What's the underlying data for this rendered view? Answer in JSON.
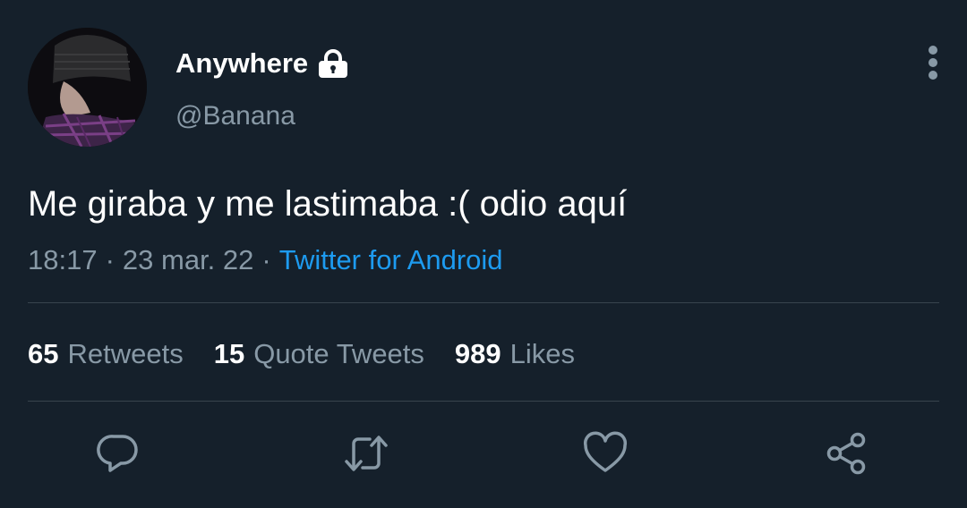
{
  "user": {
    "display_name": "Anywhere",
    "handle": "@Banana"
  },
  "tweet": {
    "text": "Me giraba y me lastimaba :( odio aquí",
    "time": "18:17",
    "date": "23 mar. 22",
    "source": "Twitter for Android",
    "separator": "·"
  },
  "stats": [
    {
      "count": "65",
      "label": "Retweets"
    },
    {
      "count": "15",
      "label": "Quote Tweets"
    },
    {
      "count": "989",
      "label": "Likes"
    }
  ],
  "icons": {
    "lock": "lock-icon",
    "more": "more-vertical-icon",
    "reply": "reply-icon",
    "retweet": "retweet-icon",
    "like": "heart-icon",
    "share": "share-icon"
  },
  "colors": {
    "background": "#15202b",
    "secondary_text": "#8899a6",
    "link": "#1d9bf0",
    "divider": "#38444d"
  }
}
